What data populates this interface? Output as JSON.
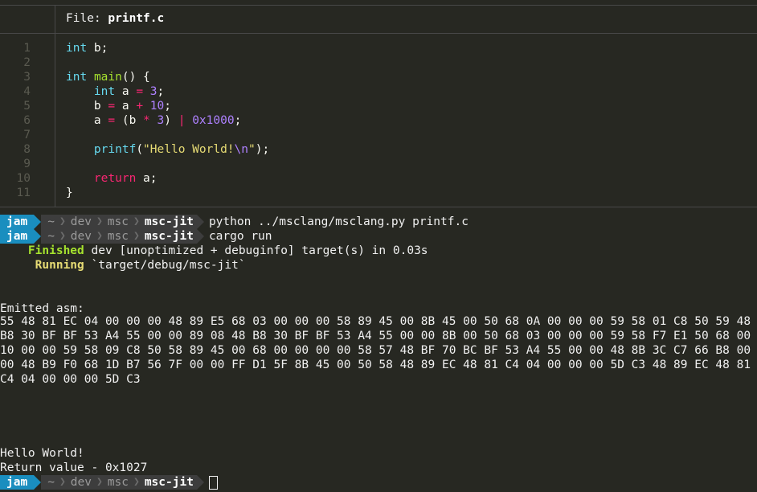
{
  "viewer": {
    "header_prefix": "File: ",
    "filename": "printf.c",
    "lines": [
      {
        "n": "1",
        "tokens": [
          [
            "kw-type",
            "int"
          ],
          [
            "plain",
            " b;"
          ]
        ]
      },
      {
        "n": "2",
        "tokens": []
      },
      {
        "n": "3",
        "tokens": [
          [
            "kw-type",
            "int"
          ],
          [
            "plain",
            " "
          ],
          [
            "fn",
            "main"
          ],
          [
            "plain",
            "() {"
          ]
        ]
      },
      {
        "n": "4",
        "tokens": [
          [
            "plain",
            "    "
          ],
          [
            "kw-type",
            "int"
          ],
          [
            "plain",
            " a "
          ],
          [
            "op",
            "="
          ],
          [
            "plain",
            " "
          ],
          [
            "num",
            "3"
          ],
          [
            "plain",
            ";"
          ]
        ]
      },
      {
        "n": "5",
        "tokens": [
          [
            "plain",
            "    b "
          ],
          [
            "op",
            "="
          ],
          [
            "plain",
            " a "
          ],
          [
            "op",
            "+"
          ],
          [
            "plain",
            " "
          ],
          [
            "num",
            "10"
          ],
          [
            "plain",
            ";"
          ]
        ]
      },
      {
        "n": "6",
        "tokens": [
          [
            "plain",
            "    a "
          ],
          [
            "op",
            "="
          ],
          [
            "plain",
            " (b "
          ],
          [
            "op",
            "*"
          ],
          [
            "plain",
            " "
          ],
          [
            "num",
            "3"
          ],
          [
            "plain",
            ") "
          ],
          [
            "op",
            "|"
          ],
          [
            "plain",
            " "
          ],
          [
            "num",
            "0x1000"
          ],
          [
            "plain",
            ";"
          ]
        ]
      },
      {
        "n": "7",
        "tokens": []
      },
      {
        "n": "8",
        "tokens": [
          [
            "plain",
            "    "
          ],
          [
            "kw-type",
            "printf"
          ],
          [
            "plain",
            "("
          ],
          [
            "str",
            "\"Hello World!"
          ],
          [
            "num",
            "\\n"
          ],
          [
            "str",
            "\""
          ],
          [
            "plain",
            ");"
          ]
        ]
      },
      {
        "n": "9",
        "tokens": []
      },
      {
        "n": "10",
        "tokens": [
          [
            "plain",
            "    "
          ],
          [
            "kw",
            "return"
          ],
          [
            "plain",
            " a;"
          ]
        ]
      },
      {
        "n": "11",
        "tokens": [
          [
            "plain",
            "}"
          ]
        ]
      }
    ]
  },
  "prompt": {
    "user": "jam",
    "path": [
      "~",
      "dev",
      "msc"
    ],
    "current_dir": "msc-jit"
  },
  "commands": [
    "python ../msclang/msclang.py printf.c",
    "cargo run"
  ],
  "cargo": {
    "finished_label": "Finished",
    "finished_text": " dev [unoptimized + debuginfo] target(s) in 0.03s",
    "running_label": "Running",
    "running_text": " `target/debug/msc-jit`"
  },
  "output": {
    "asm_label": "Emitted asm:",
    "asm_bytes": "55 48 81 EC 04 00 00 00 48 89 E5 68 03 00 00 00 58 89 45 00 8B 45 00 50 68 0A 00 00 00 59 58 01 C8 50 59 48 B8 30 BF BF 53 A4 55 00 00 89 08 48 B8 30 BF BF 53 A4 55 00 00 8B 00 50 68 03 00 00 00 59 58 F7 E1 50 68 00 10 00 00 59 58 09 C8 50 58 89 45 00 68 00 00 00 00 58 57 48 BF 70 BC BF 53 A4 55 00 00 48 8B 3C C7 66 B8 00 00 48 B9 F0 68 1D B7 56 7F 00 00 FF D1 5F 8B 45 00 50 58 48 89 EC 48 81 C4 04 00 00 00 5D C3 48 89 EC 48 81 C4 04 00 00 00 5D C3",
    "hello": "Hello World!",
    "return_value": "Return value - 0x1027"
  },
  "colors": {
    "background": "#272822",
    "prompt_user_bg": "#1a8ebf",
    "prompt_path_bg": "#3d3d3d",
    "cargo_finished": "#a6e22e",
    "cargo_running": "#e6db74"
  }
}
